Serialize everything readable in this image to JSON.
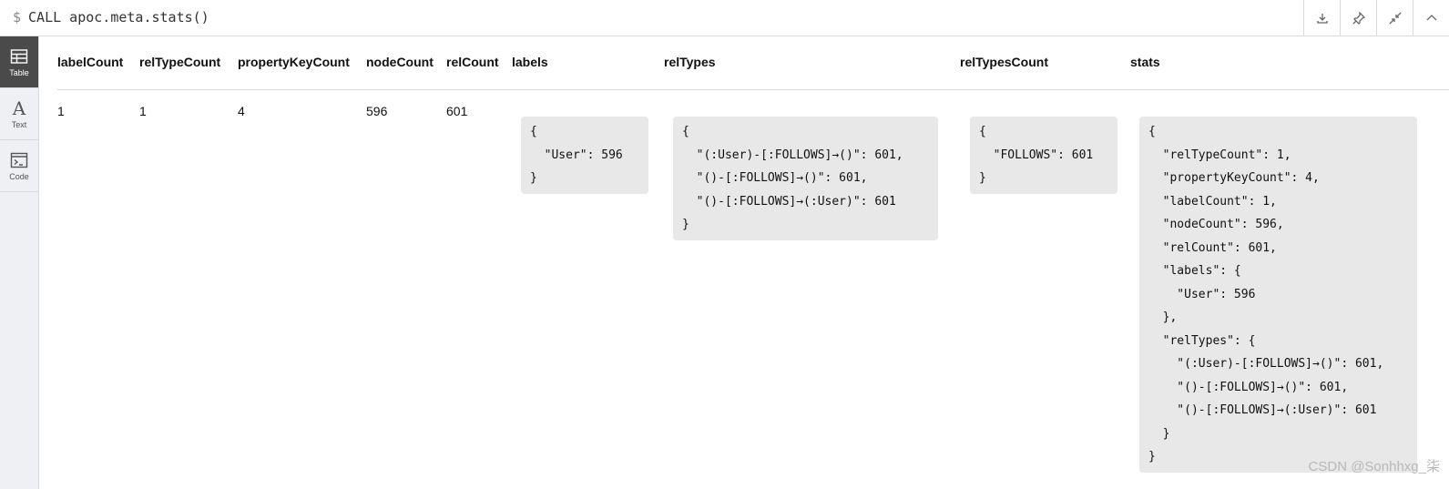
{
  "query": {
    "prompt": "$",
    "text": "CALL apoc.meta.stats()"
  },
  "toolbar": {
    "buttons": [
      "download-icon",
      "pin-icon",
      "collapse-icon",
      "chevron-up-icon"
    ]
  },
  "sidebar": {
    "items": [
      {
        "label": "Table",
        "icon": "table-icon",
        "active": true
      },
      {
        "label": "Text",
        "icon": "text-icon",
        "glyph": "A",
        "active": false
      },
      {
        "label": "Code",
        "icon": "code-icon",
        "active": false
      }
    ]
  },
  "table": {
    "columns": [
      "labelCount",
      "relTypeCount",
      "propertyKeyCount",
      "nodeCount",
      "relCount",
      "labels",
      "relTypes",
      "relTypesCount",
      "stats"
    ],
    "row": {
      "labelCount": "1",
      "relTypeCount": "1",
      "propertyKeyCount": "4",
      "nodeCount": "596",
      "relCount": "601",
      "labels": "{\n  \"User\": 596\n}",
      "relTypes": "{\n  \"(:User)-[:FOLLOWS]→()\": 601,\n  \"()-[:FOLLOWS]→()\": 601,\n  \"()-[:FOLLOWS]→(:User)\": 601\n}",
      "relTypesCount": "{\n  \"FOLLOWS\": 601\n}",
      "stats": "{\n  \"relTypeCount\": 1,\n  \"propertyKeyCount\": 4,\n  \"labelCount\": 1,\n  \"nodeCount\": 596,\n  \"relCount\": 601,\n  \"labels\": {\n    \"User\": 596\n  },\n  \"relTypes\": {\n    \"(:User)-[:FOLLOWS]→()\": 601,\n    \"()-[:FOLLOWS]→()\": 601,\n    \"()-[:FOLLOWS]→(:User)\": 601\n  }\n}"
    }
  },
  "watermark": "CSDN @Sonhhxg_柒"
}
